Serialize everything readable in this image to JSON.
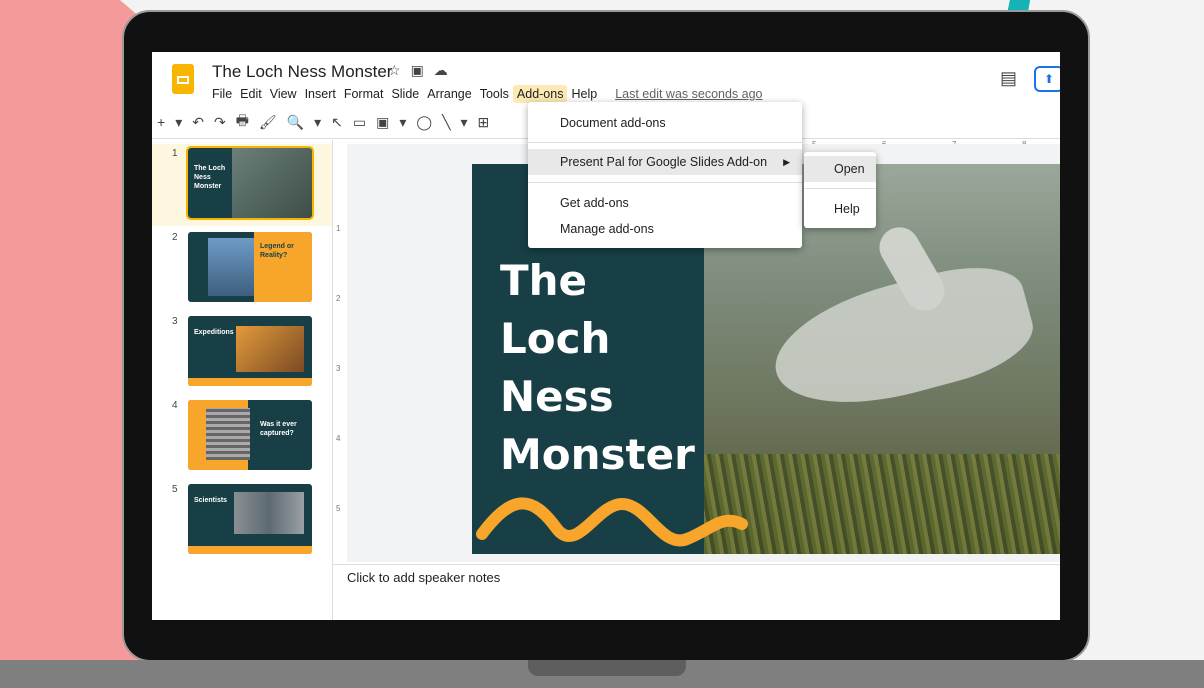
{
  "window": {
    "title": "The Loch Ness Monster"
  },
  "title_icons": [
    "star-icon",
    "folder-icon",
    "cloud-icon"
  ],
  "menubar": {
    "items": [
      "File",
      "Edit",
      "View",
      "Insert",
      "Format",
      "Slide",
      "Arrange",
      "Tools",
      "Add-ons",
      "Help"
    ],
    "active": "Add-ons",
    "last_edit": "Last edit was seconds ago"
  },
  "toolbar": {
    "items": [
      "+",
      "▾",
      "↶",
      "↷",
      "🖶",
      "🖌",
      "🔍",
      "▾",
      "↖",
      "▭",
      "▣",
      "▾",
      "◯",
      "╲",
      "▾",
      "⊞"
    ]
  },
  "ruler": {
    "ticks": [
      "5",
      "6",
      "7",
      "8"
    ]
  },
  "filmstrip": {
    "slides": [
      {
        "number": "1",
        "title": "The Loch Ness Monster"
      },
      {
        "number": "2",
        "title": "Legend or Reality?"
      },
      {
        "number": "3",
        "title": "Expeditions"
      },
      {
        "number": "4",
        "title": "Was it ever captured?"
      },
      {
        "number": "5",
        "title": "Scientists"
      }
    ]
  },
  "vruler": {
    "ticks": [
      "1",
      "2",
      "3",
      "4",
      "5"
    ]
  },
  "slide": {
    "title_lines": [
      "The",
      "Loch",
      "Ness",
      "Monster"
    ]
  },
  "notes": {
    "placeholder": "Click to add speaker notes"
  },
  "addons_menu": {
    "items": [
      {
        "label": "Document add-ons"
      },
      {
        "label": "Present Pal for Google Slides Add-on",
        "has_submenu": true
      },
      {
        "label": "Get add-ons"
      },
      {
        "label": "Manage add-ons"
      }
    ]
  },
  "submenu": {
    "items": [
      "Open",
      "Help"
    ]
  },
  "colors": {
    "accent": "#f7a62b",
    "slide_bg": "#183f46",
    "arrow": "#13b3b6",
    "pink": "#f49a9a"
  }
}
